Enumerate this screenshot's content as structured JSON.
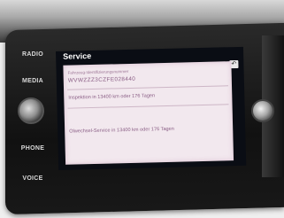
{
  "side_buttons": [
    "RADIO",
    "MEDIA",
    "PHONE",
    "VOICE"
  ],
  "screen": {
    "title": "Service",
    "back_glyph": "↶",
    "rows": [
      "Fahrzeug-Identifizierungsnummer",
      "WVWZZZ3CZFE028440",
      "Inspektion in 13400 km oder 176 Tagen",
      "Ölwechsel-Service in 13400 km oder 176 Tagen"
    ]
  }
}
